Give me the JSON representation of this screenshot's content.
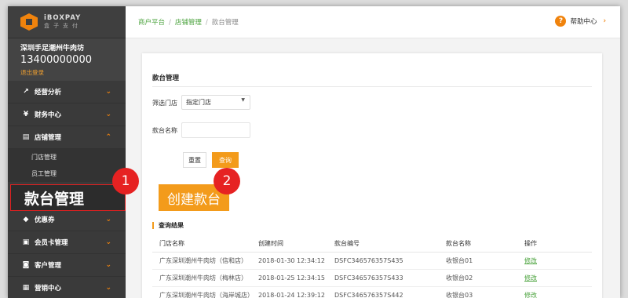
{
  "brand": {
    "name_en": "iBOXPAY",
    "name_cn": "盒子支付"
  },
  "merchant": {
    "store_name": "深圳手足潮州牛肉坊",
    "phone": "13400000000",
    "logout": "退出登录"
  },
  "sidebar": {
    "menu_top": [
      {
        "label": "经营分析",
        "icon": "chart-icon",
        "glyph": "↗"
      },
      {
        "label": "财务中心",
        "icon": "yen-icon",
        "glyph": "¥"
      },
      {
        "label": "店铺管理",
        "icon": "shop-icon",
        "glyph": "▤"
      }
    ],
    "sub_items": [
      "门店管理",
      "员工管理"
    ],
    "active_sub": "款台管理",
    "menu_bottom": [
      {
        "label": "优惠券",
        "icon": "ticket-icon",
        "glyph": "◆"
      },
      {
        "label": "会员卡管理",
        "icon": "card-icon",
        "glyph": "▣"
      },
      {
        "label": "客户管理",
        "icon": "user-icon",
        "glyph": "◙"
      },
      {
        "label": "营销中心",
        "icon": "marketing-icon",
        "glyph": "▦"
      }
    ]
  },
  "breadcrumb": {
    "items": [
      "商户平台",
      "店铺管理",
      "款台管理"
    ],
    "sep": "/"
  },
  "help": {
    "label": "帮助中心",
    "icon_glyph": "?",
    "chev": "›"
  },
  "page": {
    "title": "款台管理",
    "filter_store_label": "筛选门店",
    "filter_store_value": "指定门店",
    "name_label": "款台名称",
    "reset_label": "重置",
    "query_label": "查询",
    "create_label": "创建款台",
    "result_title": "查询结果"
  },
  "annotations": {
    "badge1": "1",
    "badge2": "2"
  },
  "table": {
    "headers": [
      "门店名称",
      "创建时间",
      "款台编号",
      "款台名称",
      "操作"
    ],
    "rows": [
      [
        "广东深圳潮州牛肉坊（信和店）",
        "2018-01-30 12:34:12",
        "DSFC346576357S435",
        "收银台01",
        "修改"
      ],
      [
        "广东深圳潮州牛肉坊（梅林店）",
        "2018-01-25 12:34:15",
        "DSFC346576357S433",
        "收银台02",
        "修改"
      ],
      [
        "广东深圳潮州牛肉坊（海岸城店）",
        "2018-01-24 12:39:12",
        "DSFC346576357S442",
        "收银台03",
        "修改"
      ]
    ]
  },
  "colors": {
    "accent": "#f39b1b",
    "sidebar_bg": "#3a3a3a",
    "link_green": "#4aa23c",
    "badge_red": "#e62222"
  }
}
